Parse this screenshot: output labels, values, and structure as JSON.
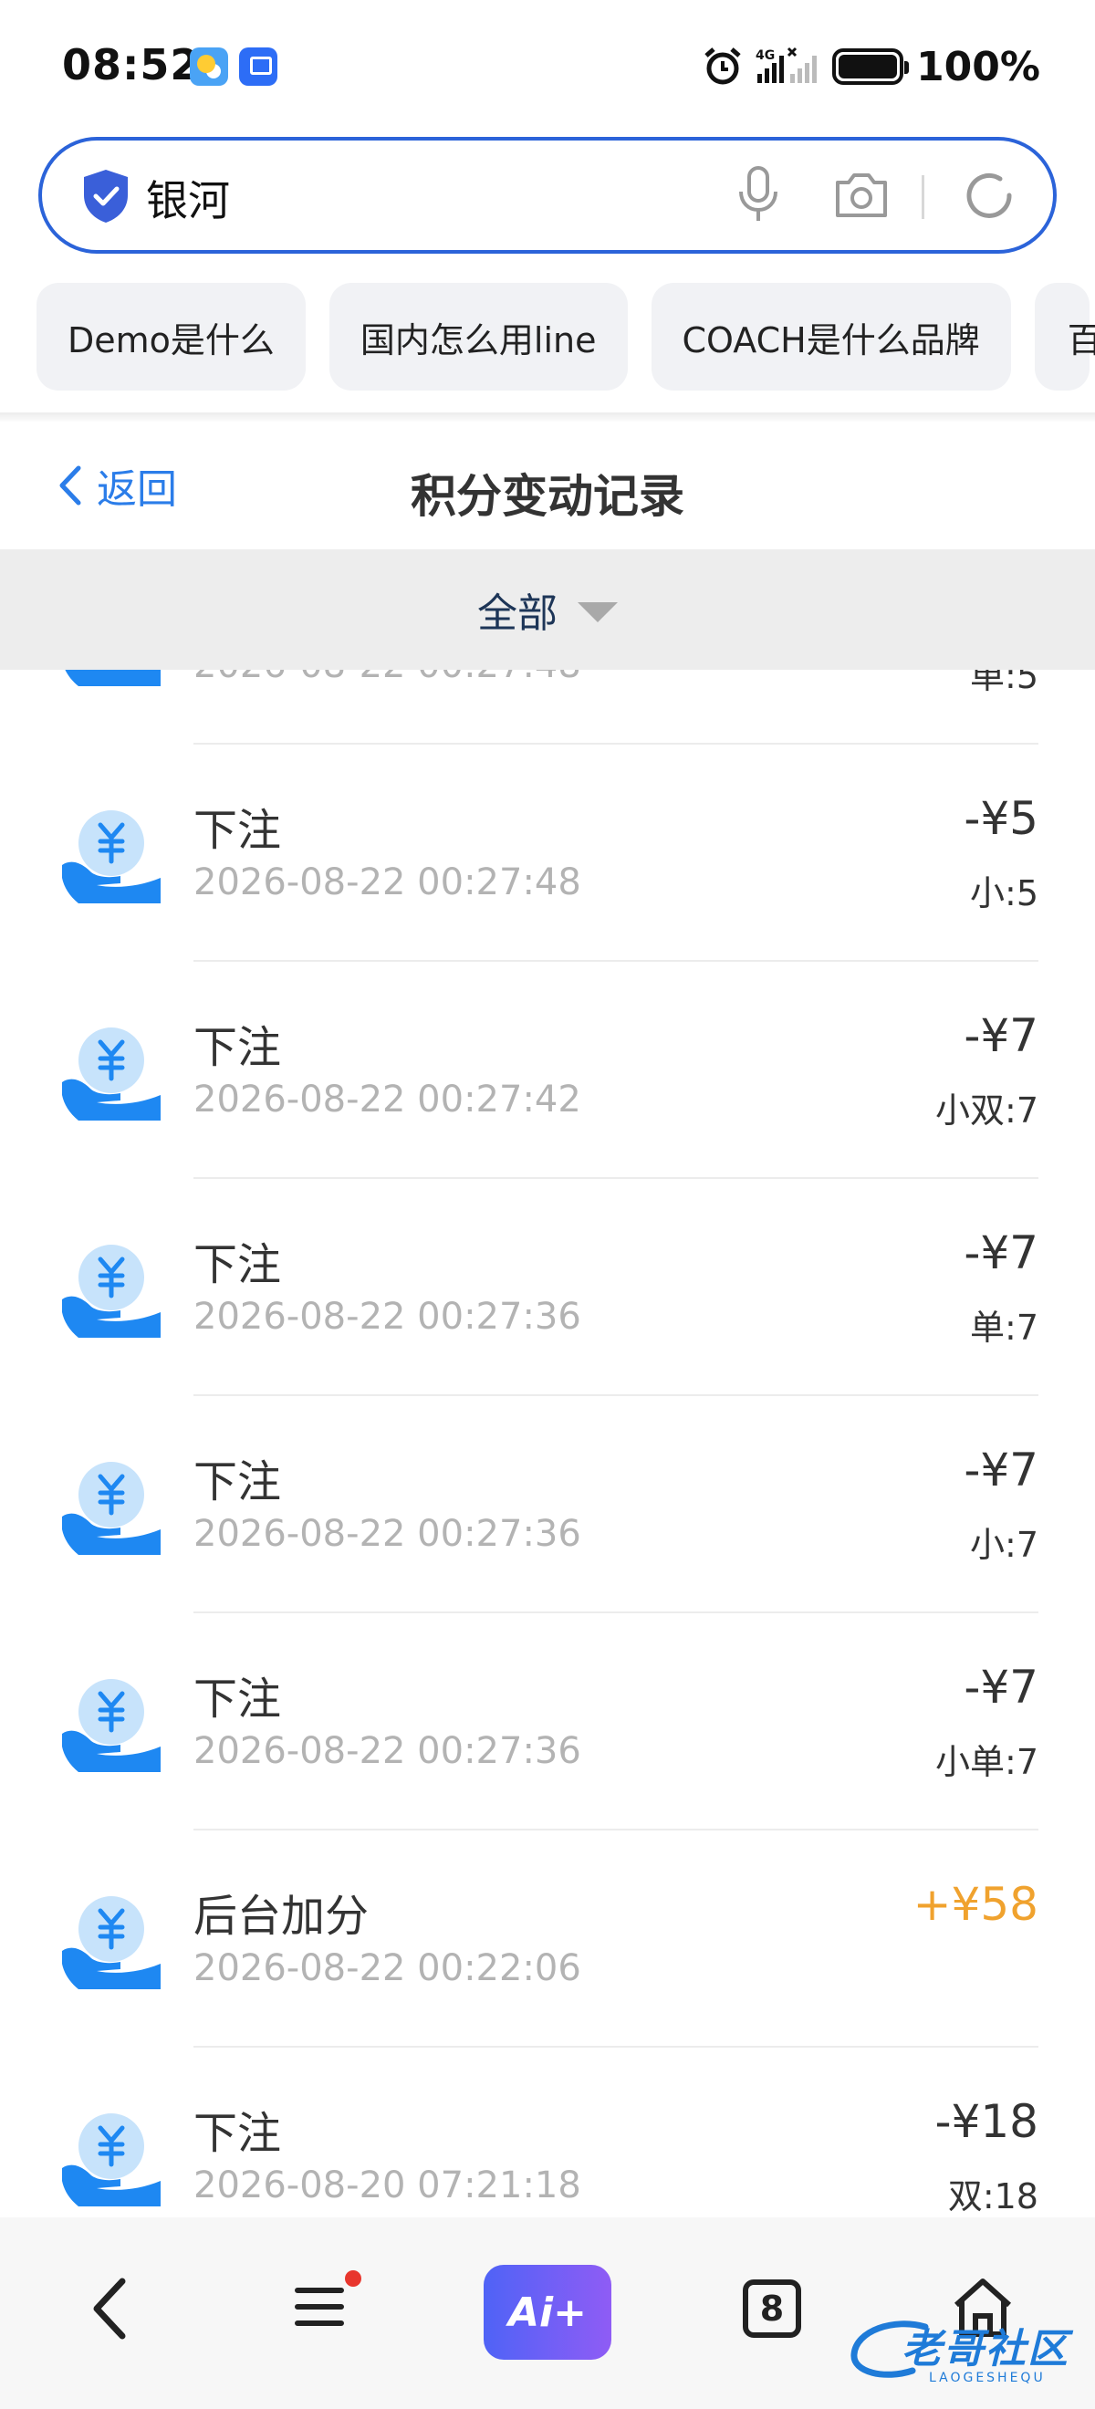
{
  "status_bar": {
    "time": "08:52",
    "network": "4G",
    "battery": "100%",
    "icons": [
      "weather-app-icon",
      "app-market-icon",
      "alarm-icon",
      "signal-icon",
      "battery-icon"
    ]
  },
  "search": {
    "query": "银河",
    "icons": [
      "shield-icon",
      "mic-icon",
      "camera-icon",
      "refresh-icon"
    ]
  },
  "suggestions": [
    "Demo是什么",
    "国内怎么用line",
    "COACH是什么品牌",
    "百"
  ],
  "header": {
    "back_label": "返回",
    "title": "积分变动记录"
  },
  "filter": {
    "selected": "全部"
  },
  "records": [
    {
      "title": "",
      "time": "2026-08-22 00:27:48",
      "amount": "",
      "note": "单:5",
      "positive": false
    },
    {
      "title": "下注",
      "time": "2026-08-22 00:27:48",
      "amount": "-¥5",
      "note": "小:5",
      "positive": false
    },
    {
      "title": "下注",
      "time": "2026-08-22 00:27:42",
      "amount": "-¥7",
      "note": "小双:7",
      "positive": false
    },
    {
      "title": "下注",
      "time": "2026-08-22 00:27:36",
      "amount": "-¥7",
      "note": "单:7",
      "positive": false
    },
    {
      "title": "下注",
      "time": "2026-08-22 00:27:36",
      "amount": "-¥7",
      "note": "小:7",
      "positive": false
    },
    {
      "title": "下注",
      "time": "2026-08-22 00:27:36",
      "amount": "-¥7",
      "note": "小单:7",
      "positive": false
    },
    {
      "title": "后台加分",
      "time": "2026-08-22 00:22:06",
      "amount": "+¥58",
      "note": "",
      "positive": true
    },
    {
      "title": "下注",
      "time": "2026-08-20 07:21:18",
      "amount": "-¥18",
      "note": "双:18",
      "positive": false
    }
  ],
  "colors": {
    "accent": "#2b7de9",
    "search_border": "#2b63d9",
    "positive_amount": "#f0a22e",
    "icon_blue": "#1e88f2",
    "icon_light": "#c7e3fb"
  },
  "bottom_nav": {
    "ai_label": "Ai+",
    "tab_count": "8",
    "watermark": "老哥社区",
    "watermark_sub": "LAOGESHEQU",
    "icons": [
      "back-icon",
      "menu-icon",
      "ai-assistant-icon",
      "tabs-icon",
      "home-icon"
    ]
  }
}
